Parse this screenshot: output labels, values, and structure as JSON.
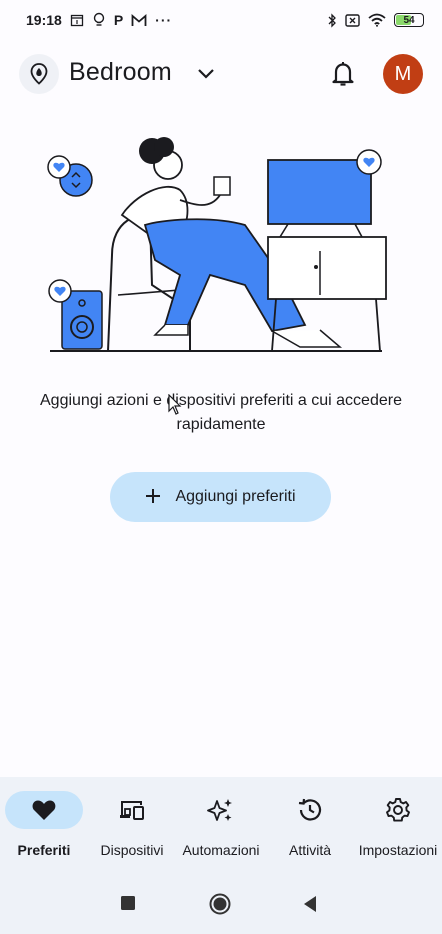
{
  "status_bar": {
    "time": "19:18",
    "icons_left": [
      "calendar-icon",
      "lightbulb-icon",
      "p-icon",
      "gmail-icon",
      "more-dots-icon"
    ],
    "p_label": "P",
    "more_label": "···",
    "icons_right": [
      "bluetooth-icon",
      "no-sim-icon",
      "wifi-icon",
      "battery-icon"
    ],
    "battery_level": "54"
  },
  "header": {
    "home_name": "Bedroom",
    "avatar_letter": "M"
  },
  "main": {
    "empty_message": "Aggiungi azioni e dispositivi preferiti a cui accedere rapidamente",
    "add_button_label": "Aggiungi preferiti"
  },
  "bottom_nav": {
    "items": [
      {
        "label": "Preferiti",
        "icon": "heart-icon",
        "active": true
      },
      {
        "label": "Dispositivi",
        "icon": "devices-icon",
        "active": false
      },
      {
        "label": "Automazioni",
        "icon": "sparkle-icon",
        "active": false
      },
      {
        "label": "Attività",
        "icon": "history-icon",
        "active": false
      },
      {
        "label": "Impostazioni",
        "icon": "gear-icon",
        "active": false
      }
    ]
  },
  "system_nav": [
    "square-icon",
    "circle-icon",
    "back-triangle-icon"
  ],
  "colors": {
    "accent": "#c6e4fb",
    "illustration_blue": "#4285f4",
    "avatar": "#c13e14",
    "nav_background": "#eef2f8"
  }
}
